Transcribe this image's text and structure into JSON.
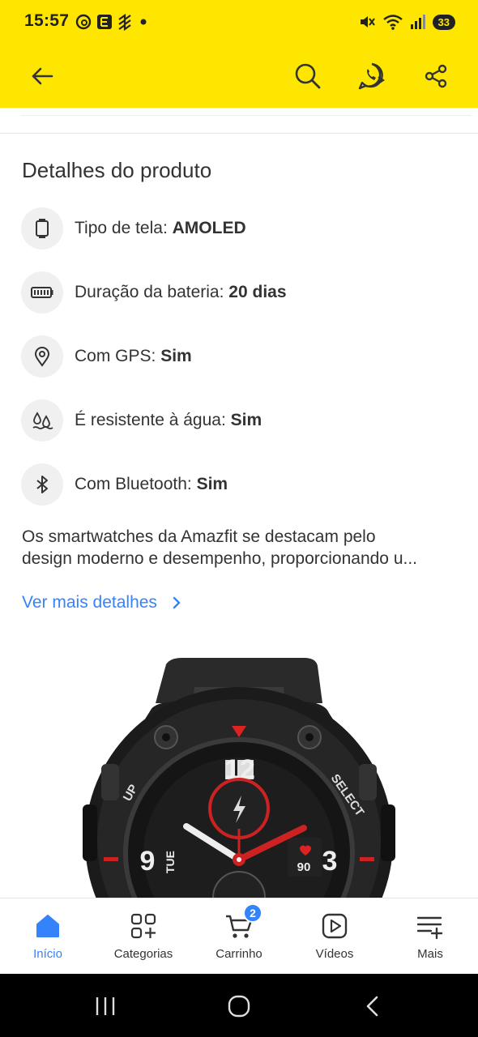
{
  "status_bar": {
    "time": "15:57",
    "battery": "33",
    "left_icons": [
      "threads-icon",
      "app-e-icon",
      "app-grid-icon",
      "dot-icon"
    ],
    "right_icons": [
      "mute-icon",
      "wifi-icon",
      "signal-icon"
    ]
  },
  "header": {
    "back_icon": "back-arrow-icon",
    "search_icon": "search-icon",
    "share_whatsapp_icon": "whatsapp-share-icon",
    "share_icon": "share-icon"
  },
  "details": {
    "title": "Detalhes do produto",
    "specs": [
      {
        "icon": "screen-icon",
        "label": "Tipo de tela: ",
        "value": "AMOLED"
      },
      {
        "icon": "battery-icon",
        "label": "Duração da bateria: ",
        "value": "20 dias"
      },
      {
        "icon": "location-pin-icon",
        "label": "Com GPS: ",
        "value": "Sim"
      },
      {
        "icon": "water-drops-icon",
        "label": "É resistente à água: ",
        "value": "Sim"
      },
      {
        "icon": "bluetooth-icon",
        "label": "Com Bluetooth: ",
        "value": "Sim"
      }
    ],
    "description_line1": "Os smartwatches da Amazfit se destacam pelo",
    "description_line2": "design moderno e desempenho, proporcionando u...",
    "more_link": "Ver mais detalhes"
  },
  "watch_image": {
    "hour_12": "12",
    "hour_9": "9",
    "hour_3": "3",
    "day": "TUE",
    "up_label": "UP",
    "select_label": "SELECT",
    "heart_rate": "90"
  },
  "bottom_nav": {
    "items": [
      {
        "label": "Início",
        "icon": "home-icon",
        "active": true
      },
      {
        "label": "Categorias",
        "icon": "categories-icon",
        "active": false
      },
      {
        "label": "Carrinho",
        "icon": "cart-icon",
        "active": false,
        "badge": "2"
      },
      {
        "label": "Vídeos",
        "icon": "video-play-icon",
        "active": false
      },
      {
        "label": "Mais",
        "icon": "more-list-icon",
        "active": false
      }
    ]
  },
  "colors": {
    "header_yellow": "#FFE600",
    "accent_blue": "#3483FA",
    "text": "#333333"
  }
}
